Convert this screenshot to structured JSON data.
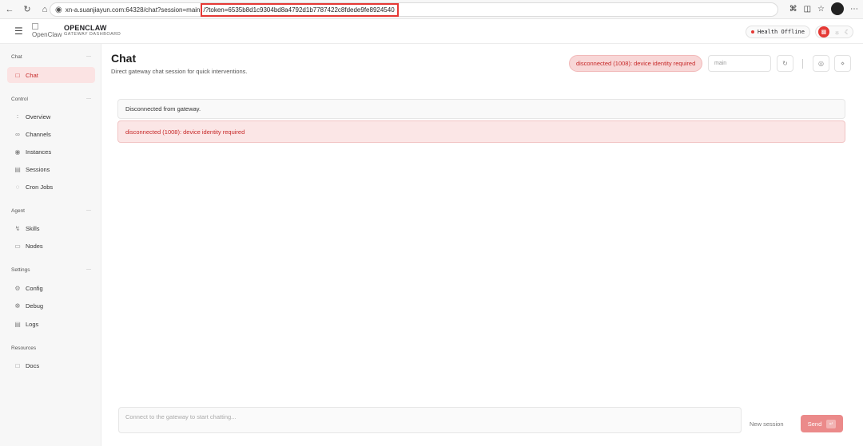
{
  "browser": {
    "url_prefix": "xn-a.suanjiayun.com:64328/chat?session=main",
    "url_token": "/?token=6535b8d1c9304bd8a4792d1b7787422c8fdede9fe8924540"
  },
  "header": {
    "logo_alt": "OpenClaw",
    "brand_name": "OPENCLAW",
    "brand_sub": "GATEWAY DASHBOARD",
    "health_label": "Health",
    "health_status": "Offline"
  },
  "sidebar": {
    "sections": [
      {
        "title": "Chat",
        "items": [
          {
            "label": "Chat",
            "icon": "chat-bubble-icon"
          }
        ]
      },
      {
        "title": "Control",
        "items": [
          {
            "label": "Overview",
            "icon": "bar-chart-icon"
          },
          {
            "label": "Channels",
            "icon": "link-icon"
          },
          {
            "label": "Instances",
            "icon": "broadcast-icon"
          },
          {
            "label": "Sessions",
            "icon": "document-icon"
          },
          {
            "label": "Cron Jobs",
            "icon": "loader-icon"
          }
        ]
      },
      {
        "title": "Agent",
        "items": [
          {
            "label": "Skills",
            "icon": "bolt-icon"
          },
          {
            "label": "Nodes",
            "icon": "monitor-icon"
          }
        ]
      },
      {
        "title": "Settings",
        "items": [
          {
            "label": "Config",
            "icon": "gear-icon"
          },
          {
            "label": "Debug",
            "icon": "bug-icon"
          },
          {
            "label": "Logs",
            "icon": "scroll-icon"
          }
        ]
      },
      {
        "title": "Resources",
        "items": [
          {
            "label": "Docs",
            "icon": "book-icon"
          }
        ]
      }
    ]
  },
  "main": {
    "title": "Chat",
    "subtitle": "Direct gateway chat session for quick interventions.",
    "error_pill": "disconnected (1008): device identity required",
    "session_value": "main",
    "info_message": "Disconnected from gateway.",
    "error_message": "disconnected (1008): device identity required",
    "composer_placeholder": "Connect to the gateway to start chatting...",
    "new_session_label": "New session",
    "send_label": "Send"
  },
  "colors": {
    "accent": "#e53935",
    "error_text": "#c62828",
    "error_bg": "#fbe6e6"
  }
}
